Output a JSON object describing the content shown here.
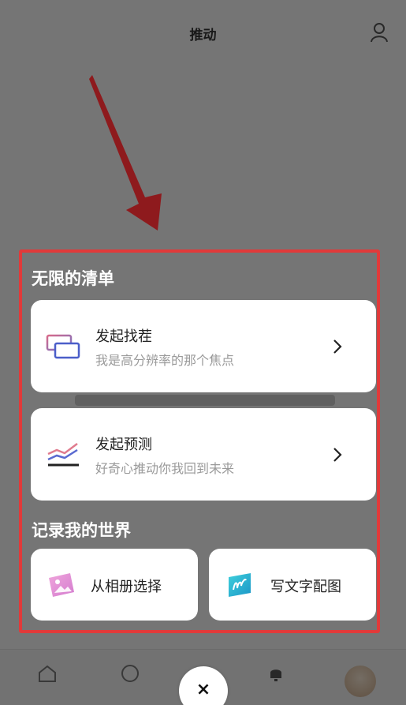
{
  "background": {
    "header_title": "推动"
  },
  "sheet": {
    "section_list_title": "无限的清单",
    "cards": [
      {
        "title": "发起找茬",
        "subtitle": "我是高分辨率的那个焦点",
        "icon": "frames-icon"
      },
      {
        "title": "发起预测",
        "subtitle": "好奇心推动你我回到未来",
        "icon": "trend-chart-icon"
      }
    ],
    "section_world_title": "记录我的世界",
    "quick_actions": [
      {
        "label": "从相册选择",
        "icon": "photo-album-icon",
        "color": "#e79ad8"
      },
      {
        "label": "写文字配图",
        "icon": "text-image-icon",
        "color": "#2db7d6"
      }
    ],
    "close_label": "×"
  },
  "colors": {
    "highlight": "#e13a3a",
    "arrow": "#8e1a1d",
    "overlay": "rgba(0,0,0,0.52)"
  }
}
